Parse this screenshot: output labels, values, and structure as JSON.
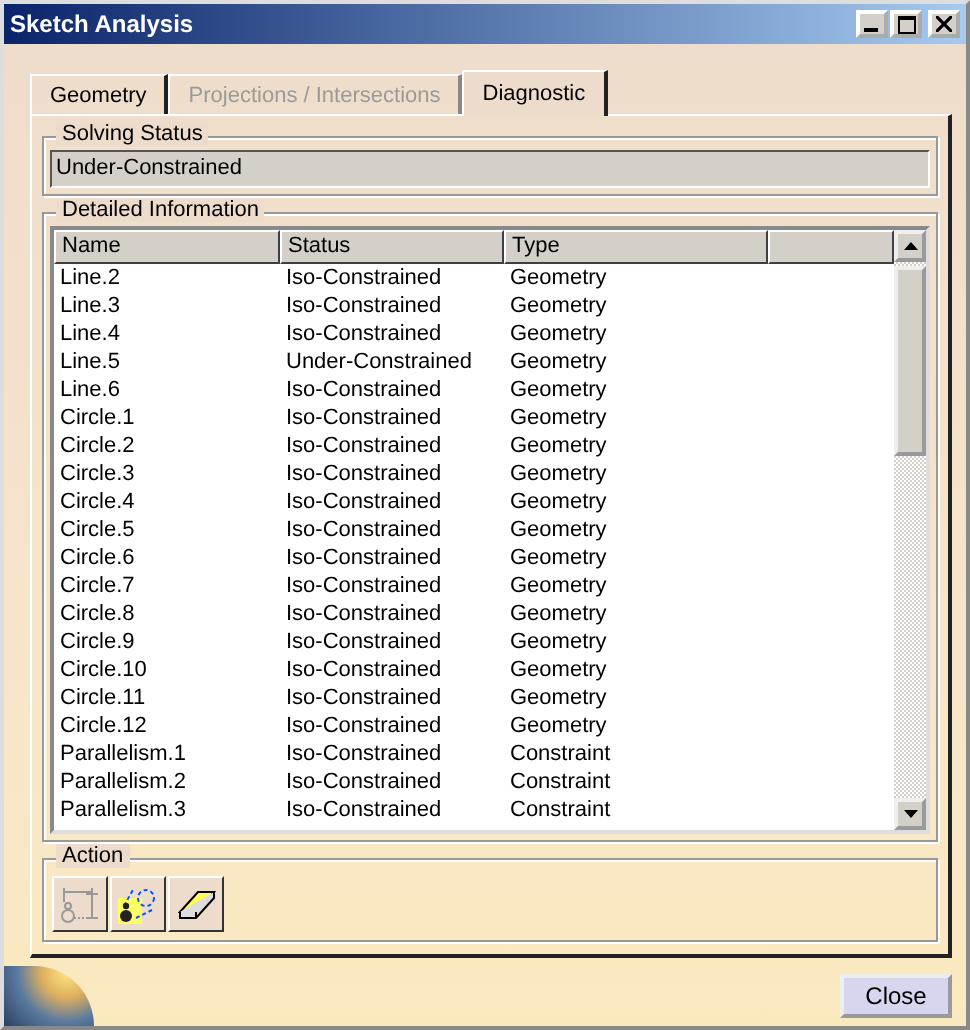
{
  "window": {
    "title": "Sketch Analysis"
  },
  "tabs": [
    {
      "label": "Geometry",
      "selected": false,
      "disabled": false
    },
    {
      "label": "Projections / Intersections",
      "selected": false,
      "disabled": true
    },
    {
      "label": "Diagnostic",
      "selected": true,
      "disabled": false
    }
  ],
  "solving_status": {
    "label": "Solving Status",
    "value": "Under-Constrained"
  },
  "detailed_information": {
    "label": "Detailed Information",
    "columns": [
      "Name",
      "Status",
      "Type"
    ],
    "rows": [
      [
        "Line.2",
        "Iso-Constrained",
        "Geometry"
      ],
      [
        "Line.3",
        "Iso-Constrained",
        "Geometry"
      ],
      [
        "Line.4",
        "Iso-Constrained",
        "Geometry"
      ],
      [
        "Line.5",
        "Under-Constrained",
        "Geometry"
      ],
      [
        "Line.6",
        "Iso-Constrained",
        "Geometry"
      ],
      [
        "Circle.1",
        "Iso-Constrained",
        "Geometry"
      ],
      [
        "Circle.2",
        "Iso-Constrained",
        "Geometry"
      ],
      [
        "Circle.3",
        "Iso-Constrained",
        "Geometry"
      ],
      [
        "Circle.4",
        "Iso-Constrained",
        "Geometry"
      ],
      [
        "Circle.5",
        "Iso-Constrained",
        "Geometry"
      ],
      [
        "Circle.6",
        "Iso-Constrained",
        "Geometry"
      ],
      [
        "Circle.7",
        "Iso-Constrained",
        "Geometry"
      ],
      [
        "Circle.8",
        "Iso-Constrained",
        "Geometry"
      ],
      [
        "Circle.9",
        "Iso-Constrained",
        "Geometry"
      ],
      [
        "Circle.10",
        "Iso-Constrained",
        "Geometry"
      ],
      [
        "Circle.11",
        "Iso-Constrained",
        "Geometry"
      ],
      [
        "Circle.12",
        "Iso-Constrained",
        "Geometry"
      ],
      [
        "Parallelism.1",
        "Iso-Constrained",
        "Constraint"
      ],
      [
        "Parallelism.2",
        "Iso-Constrained",
        "Constraint"
      ],
      [
        "Parallelism.3",
        "Iso-Constrained",
        "Constraint"
      ]
    ]
  },
  "action": {
    "label": "Action"
  },
  "buttons": [
    "Close"
  ]
}
